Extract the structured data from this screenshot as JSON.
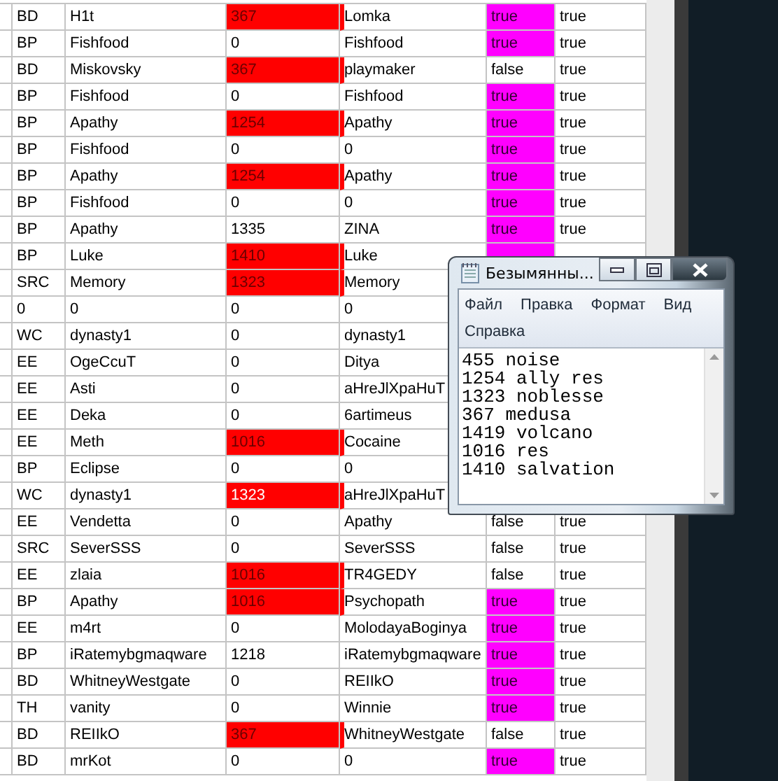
{
  "table": {
    "rows": [
      {
        "col1": "BD",
        "col2": "H1t",
        "col3": "367",
        "highlighted": true,
        "focused": false,
        "col4": "Lomka",
        "flag_on": true,
        "flag_text": "true",
        "col6": "true"
      },
      {
        "col1": "BP",
        "col2": "Fishfood",
        "col3": "0",
        "highlighted": false,
        "focused": false,
        "col4": "Fishfood",
        "flag_on": true,
        "flag_text": "true",
        "col6": "true"
      },
      {
        "col1": "BD",
        "col2": "Miskovsky",
        "col3": "367",
        "highlighted": true,
        "focused": false,
        "col4": "playmaker",
        "flag_on": false,
        "flag_text": "false",
        "col6": "true"
      },
      {
        "col1": "BP",
        "col2": "Fishfood",
        "col3": "0",
        "highlighted": false,
        "focused": false,
        "col4": "Fishfood",
        "flag_on": true,
        "flag_text": "true",
        "col6": "true"
      },
      {
        "col1": "BP",
        "col2": "Apathy",
        "col3": "1254",
        "highlighted": true,
        "focused": false,
        "col4": "Apathy",
        "flag_on": true,
        "flag_text": "true",
        "col6": "true"
      },
      {
        "col1": "BP",
        "col2": "Fishfood",
        "col3": "0",
        "highlighted": false,
        "focused": false,
        "col4": "0",
        "flag_on": true,
        "flag_text": "true",
        "col6": "true"
      },
      {
        "col1": "BP",
        "col2": "Apathy",
        "col3": "1254",
        "highlighted": true,
        "focused": false,
        "col4": "Apathy",
        "flag_on": true,
        "flag_text": "true",
        "col6": "true"
      },
      {
        "col1": "BP",
        "col2": "Fishfood",
        "col3": "0",
        "highlighted": false,
        "focused": false,
        "col4": "0",
        "flag_on": true,
        "flag_text": "true",
        "col6": "true"
      },
      {
        "col1": "BP",
        "col2": "Apathy",
        "col3": "1335",
        "highlighted": false,
        "focused": false,
        "col4": "ZINA",
        "flag_on": true,
        "flag_text": "true",
        "col6": "true"
      },
      {
        "col1": "BP",
        "col2": "Luke",
        "col3": "1410",
        "highlighted": true,
        "focused": false,
        "col4": "Luke",
        "flag_on": true
      },
      {
        "col1": "SRC",
        "col2": "Memory",
        "col3": "1323",
        "highlighted": true,
        "focused": false,
        "col4": "Memory"
      },
      {
        "col1": "0",
        "col2": "0",
        "col3": "0",
        "highlighted": false,
        "focused": false,
        "col4": "0"
      },
      {
        "col1": "WC",
        "col2": "dynasty1",
        "col3": "0",
        "highlighted": false,
        "focused": false,
        "col4": "dynasty1"
      },
      {
        "col1": "EE",
        "col2": "OgeCcuT",
        "col3": "0",
        "highlighted": false,
        "focused": false,
        "col4": "Ditya"
      },
      {
        "col1": "EE",
        "col2": "Asti",
        "col3": "0",
        "highlighted": false,
        "focused": false,
        "col4": "aHreJlXpaHuT"
      },
      {
        "col1": "EE",
        "col2": "Deka",
        "col3": "0",
        "highlighted": false,
        "focused": false,
        "col4": "6artimeus"
      },
      {
        "col1": "EE",
        "col2": "Meth",
        "col3": "1016",
        "highlighted": true,
        "focused": false,
        "col4": "Cocaine"
      },
      {
        "col1": "BP",
        "col2": "Eclipse",
        "col3": "0",
        "highlighted": false,
        "focused": false,
        "col4": "0"
      },
      {
        "col1": "WC",
        "col2": "dynasty1",
        "col3": "1323",
        "highlighted": true,
        "focused": true,
        "col4": "aHreJlXpaHuT"
      },
      {
        "col1": "EE",
        "col2": "Vendetta",
        "col3": "0",
        "highlighted": false,
        "focused": false,
        "col4": "Apathy",
        "flag_on": false,
        "flag_text": "false",
        "col6": "true"
      },
      {
        "col1": "SRC",
        "col2": "SeverSSS",
        "col3": "0",
        "highlighted": false,
        "focused": false,
        "col4": "SeverSSS",
        "flag_on": false,
        "flag_text": "false",
        "col6": "true"
      },
      {
        "col1": "EE",
        "col2": "zlaia",
        "col3": "1016",
        "highlighted": true,
        "focused": false,
        "col4": "TR4GEDY",
        "flag_on": false,
        "flag_text": "false",
        "col6": "true"
      },
      {
        "col1": "BP",
        "col2": "Apathy",
        "col3": "1016",
        "highlighted": true,
        "focused": false,
        "col4": "Psychopath",
        "flag_on": true,
        "flag_text": "true",
        "col6": "true"
      },
      {
        "col1": "EE",
        "col2": "m4rt",
        "col3": "0",
        "highlighted": false,
        "focused": false,
        "col4": "MolodayaBoginya",
        "flag_on": true,
        "flag_text": "true",
        "col6": "true"
      },
      {
        "col1": "BP",
        "col2": "iRatemybgmaqware",
        "col3": "1218",
        "highlighted": false,
        "focused": false,
        "col4": "iRatemybgmaqware",
        "flag_on": true,
        "flag_text": "true",
        "col6": "true"
      },
      {
        "col1": "BD",
        "col2": "WhitneyWestgate",
        "col3": "0",
        "highlighted": false,
        "focused": false,
        "col4": "REIIkO",
        "flag_on": true,
        "flag_text": "true",
        "col6": "true"
      },
      {
        "col1": "TH",
        "col2": "vanity",
        "col3": "0",
        "highlighted": false,
        "focused": false,
        "col4": "Winnie",
        "flag_on": true,
        "flag_text": "true",
        "col6": "true"
      },
      {
        "col1": "BD",
        "col2": "REIIkO",
        "col3": "367",
        "highlighted": true,
        "focused": false,
        "col4": "WhitneyWestgate",
        "flag_on": false,
        "flag_text": "false",
        "col6": "true"
      },
      {
        "col1": "BD",
        "col2": "mrKot",
        "col3": "0",
        "highlighted": false,
        "focused": false,
        "col4": "0",
        "flag_on": true,
        "flag_text": "true",
        "col6": "true"
      }
    ]
  },
  "notepad": {
    "title": "Безымянны...",
    "menu": [
      "Файл",
      "Правка",
      "Формат",
      "Вид",
      "Справка"
    ],
    "lines": [
      "455 noise",
      "1254 ally res",
      "1323 noblesse",
      "367 medusa",
      "1419 volcano",
      "1016 res",
      "1410 salvation"
    ]
  }
}
